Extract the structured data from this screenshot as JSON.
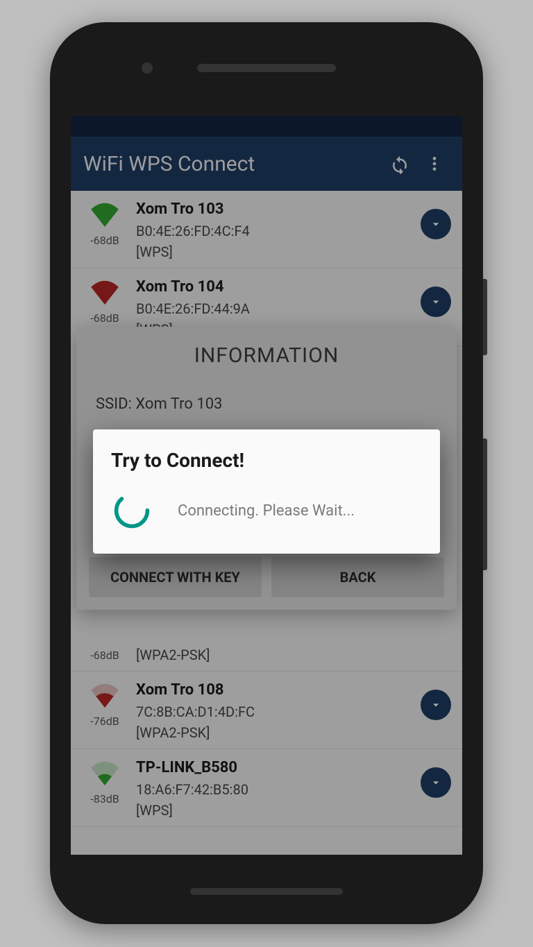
{
  "appbar": {
    "title": "WiFi WPS Connect"
  },
  "networks": [
    {
      "ssid": "Xom Tro 103",
      "mac": "B0:4E:26:FD:4C:F4",
      "security": "[WPS]",
      "signal": "-68dB",
      "color": "green",
      "strength": 1.0
    },
    {
      "ssid": "Xom Tro 104",
      "mac": "B0:4E:26:FD:44:9A",
      "security": "[WPS]",
      "signal": "-68dB",
      "color": "red",
      "strength": 1.0
    },
    {
      "ssid": "Xom Tro 108",
      "mac": "7C:8B:CA:D1:4D:FC",
      "security": "[WPA2-PSK]",
      "signal": "-76dB",
      "color": "red",
      "strength": 0.6
    },
    {
      "ssid": "TP-LINK_B580",
      "mac": "18:A6:F7:42:B5:80",
      "security": "[WPS]",
      "signal": "-83dB",
      "color": "green",
      "strength": 0.45
    }
  ],
  "partial_row": {
    "security": "[WPA2-PSK]",
    "signal": "-68dB"
  },
  "info_dialog": {
    "title": "INFORMATION",
    "ssid_line": "SSID: Xom Tro 103",
    "connect_with_key": "CONNECT WITH KEY",
    "back": "BACK"
  },
  "connect_dialog": {
    "title": "Try to Connect!",
    "message": "Connecting. Please Wait..."
  }
}
